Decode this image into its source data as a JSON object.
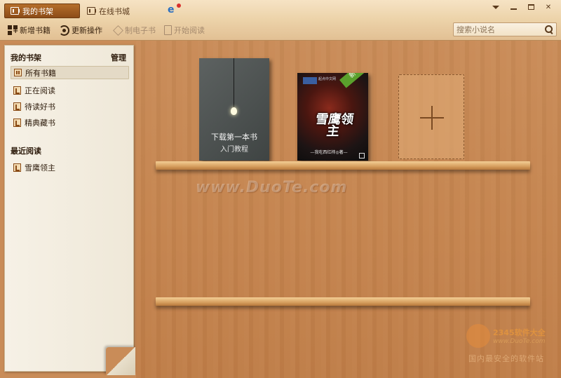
{
  "titlebar": {
    "tabs": [
      {
        "label": "我的书架",
        "active": true
      },
      {
        "label": "在线书城",
        "active": false
      }
    ]
  },
  "toolbar": {
    "add_books": "新增书籍",
    "update_ops": "更新操作",
    "make_ebook": "制电子书",
    "start_reading": "开始阅读",
    "search_placeholder": "搜索小说名"
  },
  "sidebar": {
    "shelf_header": "我的书架",
    "manage_label": "管理",
    "shelf_items": [
      {
        "label": "所有书籍",
        "selected": true
      },
      {
        "label": "正在阅读"
      },
      {
        "label": "待读好书"
      },
      {
        "label": "精典藏书"
      }
    ],
    "recent_header": "最近阅读",
    "recent_items": [
      {
        "label": "雪鹰领主"
      }
    ]
  },
  "shelf": {
    "books": [
      {
        "title": "下载第一本书",
        "subtitle": "入门教程"
      },
      {
        "title": "雪鹰领主",
        "badge": "新 1195",
        "author": "—我吃西红柿◎著—",
        "publisher": "起点中文网"
      }
    ]
  },
  "watermarks": {
    "duote": "www.DuoTe.com",
    "brand": "2345软件大全",
    "url": "www.DuoTe.com",
    "slogan": "国内最安全的软件站"
  },
  "colors": {
    "active_tab": "#9a5520",
    "wood": "#c98b57",
    "sidebar": "#f4efe3",
    "badge": "#5aa02c"
  }
}
